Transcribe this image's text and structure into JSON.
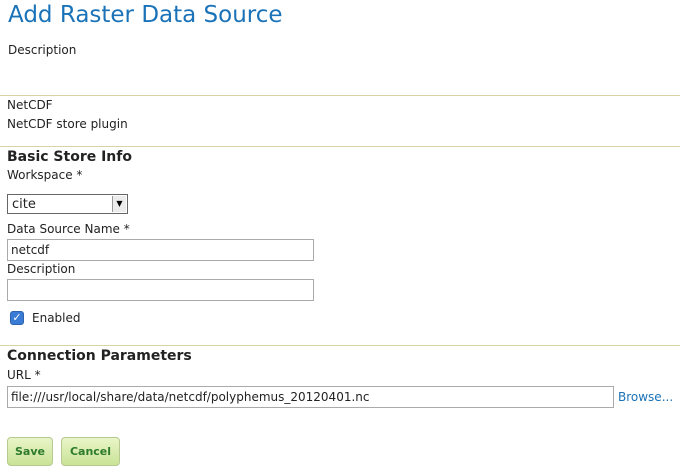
{
  "page": {
    "title": "Add Raster Data Source",
    "description_label": "Description"
  },
  "store": {
    "type_name": "NetCDF",
    "type_description": "NetCDF store plugin"
  },
  "basic_info": {
    "heading": "Basic Store Info",
    "workspace_label": "Workspace *",
    "workspace_value": "cite",
    "name_label": "Data Source Name *",
    "name_value": "netcdf",
    "description_label": "Description",
    "description_value": "",
    "enabled_label": "Enabled",
    "enabled_checked": true
  },
  "connection": {
    "heading": "Connection Parameters",
    "url_label": "URL *",
    "url_value": "file:///usr/local/share/data/netcdf/polyphemus_20120401.nc",
    "browse_label": "Browse..."
  },
  "actions": {
    "save_label": "Save",
    "cancel_label": "Cancel"
  }
}
